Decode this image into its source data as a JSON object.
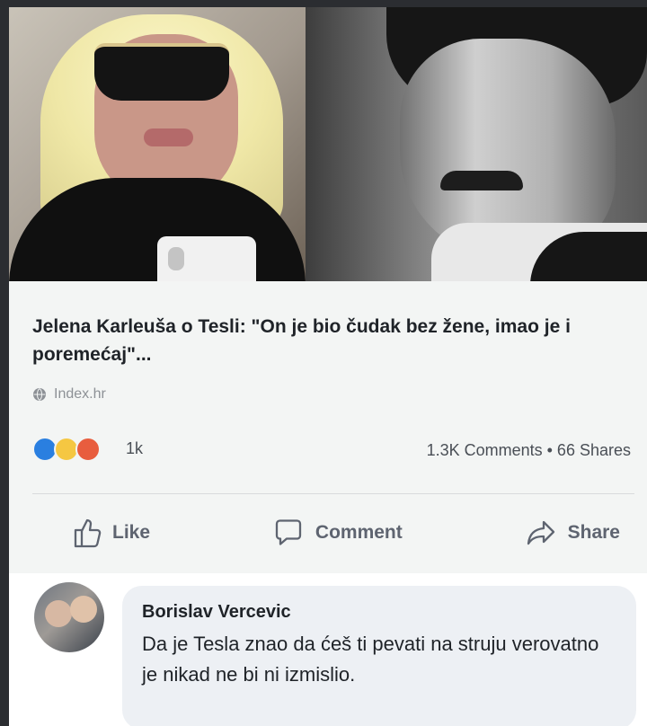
{
  "post": {
    "headline": "Jelena Karleuša o Tesli: \"On je bio čudak bez žene, imao je i poremećaj\"...",
    "source": "Index.hr",
    "reactions": {
      "icons": [
        "like-icon",
        "haha-icon",
        "angry-icon"
      ],
      "count": "1k"
    },
    "stats": "1.3K Comments • 66 Shares"
  },
  "actions": {
    "like": "Like",
    "comment": "Comment",
    "share": "Share"
  },
  "comment": {
    "author": "Borislav Vercevic",
    "text": "Da je Tesla znao da ćeš ti pevati na struju verovatno je nikad ne bi ni izmislio."
  },
  "colors": {
    "headline": "#1f2328",
    "muted": "#8d9196",
    "like_blue": "#2a7fe0",
    "haha_yellow": "#f5c742",
    "angry_red": "#e85d3e",
    "action_gray": "#5e6470",
    "comment_bg": "#edf0f4"
  }
}
